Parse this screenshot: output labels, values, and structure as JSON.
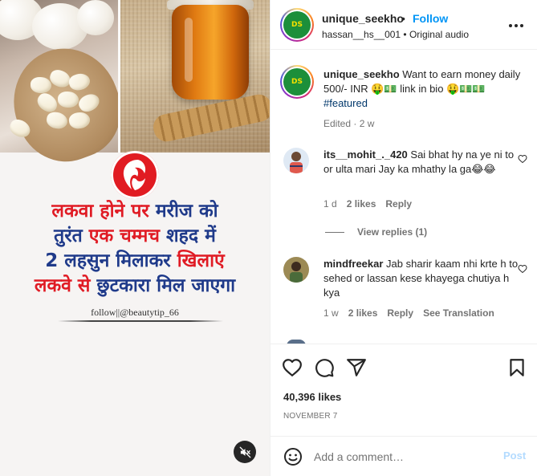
{
  "post": {
    "hindi_lines": [
      [
        {
          "t": "लकवा होने पर ",
          "c": "r"
        },
        {
          "t": "मरीज को",
          "c": "b"
        }
      ],
      [
        {
          "t": "तुरंत ",
          "c": "b"
        },
        {
          "t": "एक चम्मच ",
          "c": "r"
        },
        {
          "t": "शहद में",
          "c": "b"
        }
      ],
      [
        {
          "t": "2 लहसुन मिलाकर ",
          "c": "b"
        },
        {
          "t": "खिलाएं",
          "c": "r"
        }
      ],
      [
        {
          "t": "लकवे से ",
          "c": "r"
        },
        {
          "t": "छुटकारा मिल जाएगा",
          "c": "b"
        }
      ]
    ],
    "credit": "follow||@beautytip_66"
  },
  "header": {
    "username": "unique_seekho",
    "separator": "•",
    "follow_label": "Follow",
    "subtitle": "hassan__hs__001 • Original audio",
    "avatar_text": "DS"
  },
  "caption": {
    "username": "unique_seekho",
    "text": "Want to earn money daily 500/- INR 🤑💵 link in bio 🤑💵💵",
    "hashtag": "#featured",
    "meta": "Edited · 2 w"
  },
  "comments": [
    {
      "username": "its__mohit_._420",
      "text": "Sai bhat hy na ye ni to or ulta mari Jay ka mhathy la ga😂😂",
      "time": "1 d",
      "likes": "2 likes",
      "reply": "Reply",
      "extra": "",
      "avatar_color": "#7aa0c8"
    },
    {
      "username": "mindfreekar",
      "text": "Jab sharir kaam nhi krte h to sehed or lassan kese khayega chutiya h kya",
      "time": "1 w",
      "likes": "2 likes",
      "reply": "Reply",
      "extra": "See Translation",
      "avatar_color": "#8a7a4a"
    }
  ],
  "view_replies": "View replies (1)",
  "likes": "40,396 likes",
  "date": "NOVEMBER 7",
  "add_comment": {
    "placeholder": "Add a comment…",
    "post_label": "Post"
  },
  "colors": {
    "accent": "#0095f6",
    "hindi_red": "#e01b24",
    "hindi_blue": "#1f3a8a"
  },
  "icons": [
    "heart-icon",
    "comment-icon",
    "share-icon",
    "bookmark-icon",
    "emoji-icon",
    "more-icon",
    "mute-icon"
  ]
}
